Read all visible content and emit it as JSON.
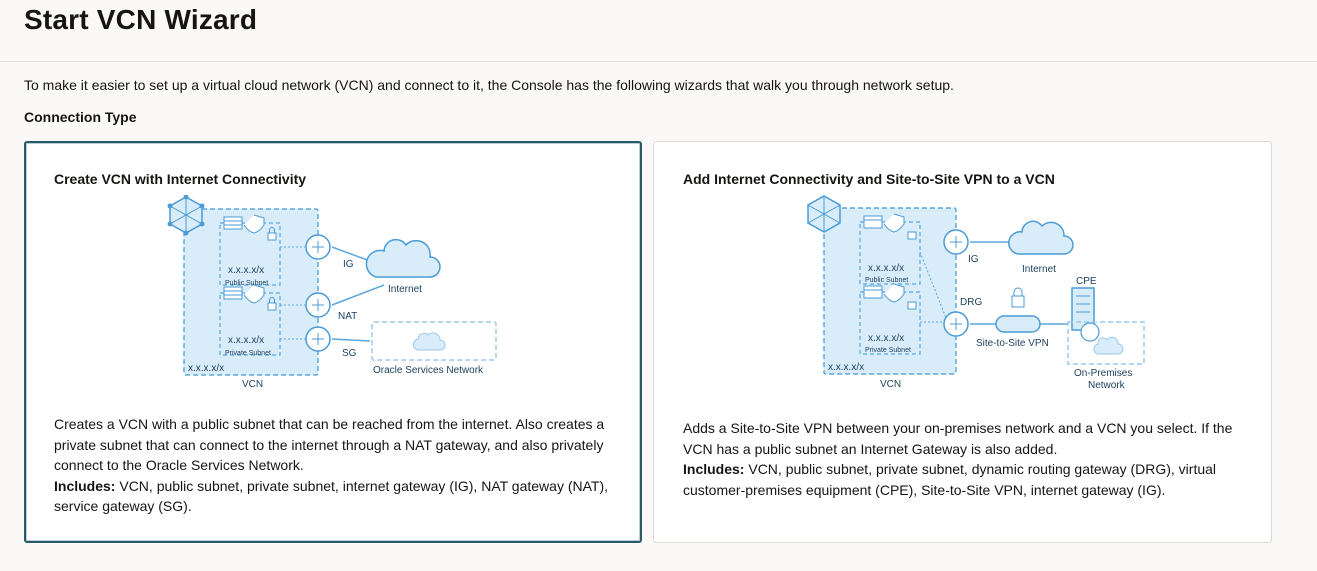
{
  "page": {
    "title": "Start VCN Wizard",
    "intro": "To make it easier to set up a virtual cloud network (VCN) and connect to it, the Console has the following wizards that walk you through network setup.",
    "connection_type_label": "Connection Type"
  },
  "colors": {
    "selected_border": "#2c5967",
    "diagram_blue": "#5aa7e0",
    "vcn_fill": "#d9ecfa"
  },
  "cards": [
    {
      "title": "Create VCN with Internet Connectivity",
      "selected": true,
      "desc": "Creates a VCN with a public subnet that can be reached from the internet. Also creates a private subnet that can connect to the internet through a NAT gateway, and also privately connect to the Oracle Services Network.",
      "includes_label": "Includes:",
      "includes_text": " VCN, public subnet, private subnet, internet gateway (IG), NAT gateway (NAT), service gateway (SG).",
      "diagram": {
        "cidr_public": "x.x.x.x/x",
        "public_subnet": "Public Subnet",
        "cidr_private": "x.x.x.x/x",
        "private_subnet": "Private Subnet",
        "cidr_vcn": "x.x.x.x/x",
        "vcn": "VCN",
        "ig": "IG",
        "nat": "NAT",
        "sg": "SG",
        "internet": "Internet",
        "osn": "Oracle Services Network"
      }
    },
    {
      "title": "Add Internet Connectivity and Site-to-Site VPN to a VCN",
      "selected": false,
      "desc": "Adds a Site-to-Site VPN between your on-premises network and a VCN you select. If the VCN has a public subnet an Internet Gateway is also added.",
      "includes_label": "Includes:",
      "includes_text": " VCN, public subnet, private subnet, dynamic routing gateway (DRG), virtual customer-premises equipment (CPE), Site-to-Site VPN, internet gateway (IG).",
      "diagram": {
        "cidr_public": "x.x.x.x/x",
        "public_subnet": "Public Subnet",
        "cidr_private": "x.x.x.x/x",
        "private_subnet": "Private Subnet",
        "cidr_vcn": "x.x.x.x/x",
        "vcn": "VCN",
        "ig": "IG",
        "internet": "Internet",
        "drg": "DRG",
        "cpe": "CPE",
        "vpn": "Site-to-Site VPN",
        "onprem_1": "On-Premises",
        "onprem_2": "Network"
      }
    }
  ]
}
